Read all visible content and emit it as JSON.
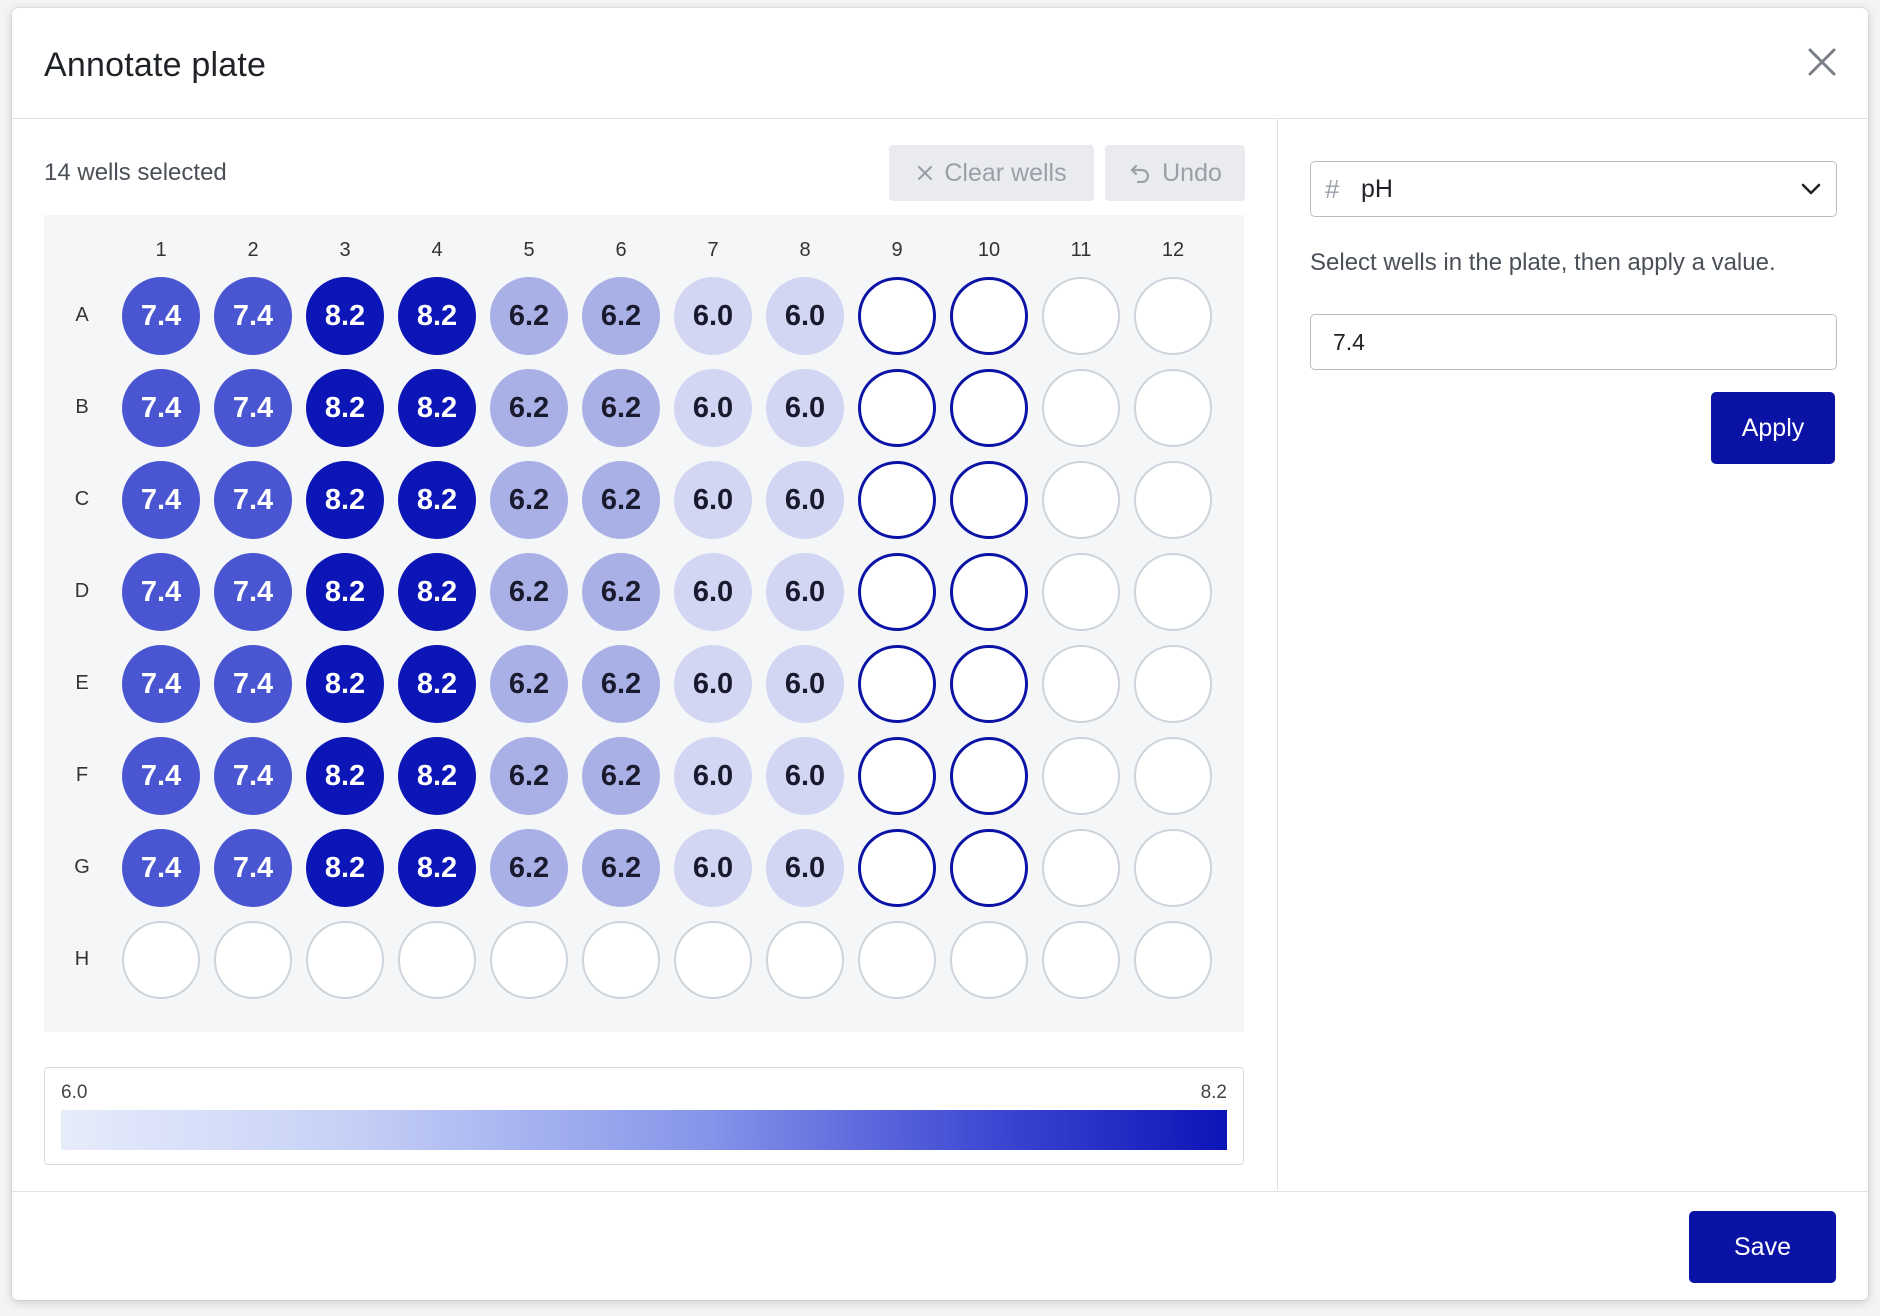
{
  "modal": {
    "title": "Annotate plate",
    "close_icon": "close-icon"
  },
  "toolbar": {
    "selected_count": "14 wells selected",
    "clear_label": "Clear wells",
    "clear_icon": "x-icon",
    "undo_label": "Undo",
    "undo_icon": "undo-icon"
  },
  "plate": {
    "columns": [
      "1",
      "2",
      "3",
      "4",
      "5",
      "6",
      "7",
      "8",
      "9",
      "10",
      "11",
      "12"
    ],
    "rows": [
      "A",
      "B",
      "C",
      "D",
      "E",
      "F",
      "G",
      "H"
    ],
    "wells": [
      [
        "7.4",
        "7.4",
        "8.2",
        "8.2",
        "6.2",
        "6.2",
        "6.0",
        "6.0",
        "",
        "",
        "",
        ""
      ],
      [
        "7.4",
        "7.4",
        "8.2",
        "8.2",
        "6.2",
        "6.2",
        "6.0",
        "6.0",
        "",
        "",
        "",
        ""
      ],
      [
        "7.4",
        "7.4",
        "8.2",
        "8.2",
        "6.2",
        "6.2",
        "6.0",
        "6.0",
        "",
        "",
        "",
        ""
      ],
      [
        "7.4",
        "7.4",
        "8.2",
        "8.2",
        "6.2",
        "6.2",
        "6.0",
        "6.0",
        "",
        "",
        "",
        ""
      ],
      [
        "7.4",
        "7.4",
        "8.2",
        "8.2",
        "6.2",
        "6.2",
        "6.0",
        "6.0",
        "",
        "",
        "",
        ""
      ],
      [
        "7.4",
        "7.4",
        "8.2",
        "8.2",
        "6.2",
        "6.2",
        "6.0",
        "6.0",
        "",
        "",
        "",
        ""
      ],
      [
        "7.4",
        "7.4",
        "8.2",
        "8.2",
        "6.2",
        "6.2",
        "6.0",
        "6.0",
        "",
        "",
        "",
        ""
      ],
      [
        "",
        "",
        "",
        "",
        "",
        "",
        "",
        "",
        "",
        "",
        "",
        ""
      ]
    ],
    "selected_wells": [
      "A9",
      "A10",
      "B9",
      "B10",
      "C9",
      "C10",
      "D9",
      "D10",
      "E9",
      "E10",
      "F9",
      "F10",
      "G9",
      "G10"
    ]
  },
  "legend": {
    "min_label": "6.0",
    "max_label": "8.2",
    "color_low": "#e7ecfb",
    "color_high": "#0c15b6"
  },
  "panel": {
    "field_icon": "hash-icon",
    "field_select_value": "pH",
    "dropdown_icon": "chevron-down-icon",
    "helper_text": "Select wells in the plate, then apply a value.",
    "value_input": "7.4",
    "apply_label": "Apply"
  },
  "footer": {
    "save_label": "Save"
  },
  "colors": {
    "primary": "#0a13a6",
    "well_8_2": "#0c15b6",
    "well_7_4": "#4a56d1",
    "well_6_2": "#a9b0e6",
    "well_6_0": "#d2d6f2"
  }
}
